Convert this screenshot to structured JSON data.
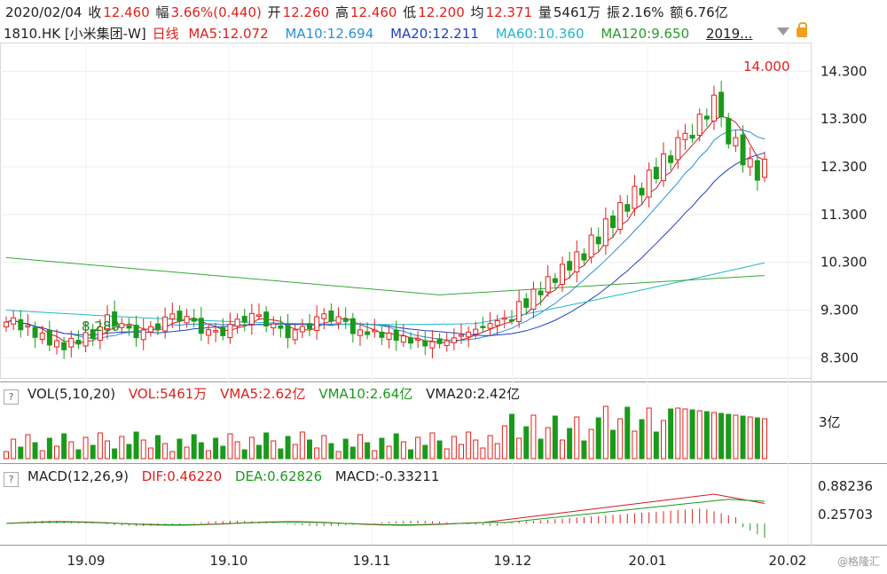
{
  "quote": {
    "date": "2020/02/04",
    "close_label": "收",
    "close": "12.460",
    "change_label": "幅",
    "change": "3.66%(0.440)",
    "open_label": "开",
    "open": "12.260",
    "high_label": "高",
    "high": "12.460",
    "low_label": "低",
    "low": "12.200",
    "avg_label": "均",
    "avg": "12.371",
    "vol_label": "量",
    "vol": "5461万",
    "amp_label": "振",
    "amp": "2.16%",
    "amt_label": "额",
    "amt": "6.76亿"
  },
  "ma_bar": {
    "symbol": "1810.HK [小米集团-W]",
    "period": "日线",
    "ma5": "MA5:12.072",
    "ma10": "MA10:12.694",
    "ma20": "MA20:12.211",
    "ma60": "MA60:10.360",
    "ma120": "MA120:9.650",
    "extra": "2019..."
  },
  "vol_bar": {
    "q": "?",
    "title": "VOL(5,10,20)",
    "vol": "VOL:5461万",
    "vma5": "VMA5:2.62亿",
    "vma10": "VMA10:2.64亿",
    "vma20": "VMA20:2.42亿"
  },
  "macd_bar": {
    "q": "?",
    "title": "MACD(12,26,9)",
    "dif": "DIF:0.46220",
    "dea": "DEA:0.62826",
    "macd": "MACD:-0.33211"
  },
  "watermark": "@格隆汇",
  "colors": {
    "up": "#e0201c",
    "down": "#1a9a1a",
    "ma5": "#d0192a",
    "ma10": "#2a8fd6",
    "ma20": "#2040c0",
    "ma60": "#22b8c8",
    "ma120": "#3aa83a"
  },
  "chart_data": {
    "type": "candlestick",
    "price_axis": {
      "ticks": [
        "14.300",
        "13.300",
        "12.300",
        "11.300",
        "10.300",
        "9.300",
        "8.300"
      ],
      "ylim": [
        7.9,
        14.9
      ]
    },
    "vol_axis": {
      "ticks": [
        "3亿"
      ]
    },
    "macd_axis": {
      "ticks": [
        "0.88236",
        "0.25703"
      ]
    },
    "x_ticks": [
      "19.09",
      "19.10",
      "19.11",
      "19.12",
      "20.01",
      "20.02"
    ],
    "annotations": {
      "high": "14.000",
      "low": "8.280"
    },
    "ma_labels": [
      "MA5",
      "MA10",
      "MA20",
      "MA60",
      "MA120"
    ]
  }
}
